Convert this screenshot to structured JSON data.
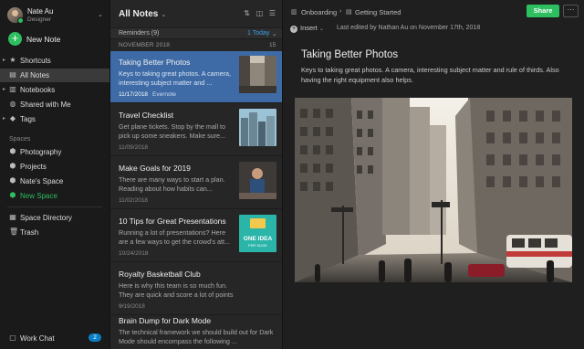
{
  "user": {
    "name": "Nate Au",
    "role": "Designer"
  },
  "sidebar": {
    "new_note": "New Note",
    "items": [
      {
        "label": "Shortcuts",
        "icon": "star-icon"
      },
      {
        "label": "All Notes",
        "icon": "note-icon"
      },
      {
        "label": "Notebooks",
        "icon": "notebook-icon"
      },
      {
        "label": "Shared with Me",
        "icon": "people-icon"
      },
      {
        "label": "Tags",
        "icon": "tag-icon"
      }
    ],
    "spaces_label": "Spaces",
    "spaces": [
      {
        "label": "Photography",
        "icon": "space-icon"
      },
      {
        "label": "Projects",
        "icon": "space-icon"
      },
      {
        "label": "Nate's Space",
        "icon": "space-icon"
      },
      {
        "label": "New Space",
        "icon": "space-icon"
      }
    ],
    "space_directory": "Space Directory",
    "trash": "Trash",
    "work_chat": "Work Chat",
    "work_chat_count": "2",
    "accent": "#2dbe60"
  },
  "list": {
    "title": "All Notes",
    "reminders": "Reminders (9)",
    "reminders_today": "1 Today",
    "month": "NOVEMBER 2018",
    "month_count": "15",
    "notes": [
      {
        "title": "Taking Better Photos",
        "snippet": "Keys to taking great photos. A camera, interesting subject matter and ...",
        "date": "11/17/2018",
        "notebook": "Evernote"
      },
      {
        "title": "Travel Checklist",
        "snippet": "Get plane tickets. Stop by the mall to pick up some sneakers. Make sure...",
        "date": "11/09/2018"
      },
      {
        "title": "Make Goals for 2019",
        "snippet": "There are many ways to start a plan. Reading about how habits can...",
        "date": "11/02/2018"
      },
      {
        "title": "10 Tips for Great Presentations",
        "snippet": "Running a lot of presentations? Here are a few ways to get the crowd's att...",
        "date": "10/24/2018",
        "thumb_text": [
          "ONE IDEA",
          "PER SLIDE"
        ]
      },
      {
        "title": "Royalty Basketball Club",
        "snippet": "Here is why this team is so much fun. They are quick and score a lot of points ...",
        "date": "9/19/2018"
      },
      {
        "title": "Brain Dump for Dark Mode",
        "snippet": "The technical framework we should build out for Dark Mode should encompass the following ..."
      }
    ],
    "selected_color": "#3e6ba6"
  },
  "editor": {
    "breadcrumb_notebook": "Onboarding",
    "breadcrumb_note": "Getting Started",
    "share": "Share",
    "more": "···",
    "insert": "Insert",
    "last_edited": "Last edited by Nathan Au on November 17th, 2018",
    "title": "Taking Better Photos",
    "body": "Keys to taking great photos. A camera, interesting subject matter and rule of thirds. Also having the right equipment also helps."
  }
}
